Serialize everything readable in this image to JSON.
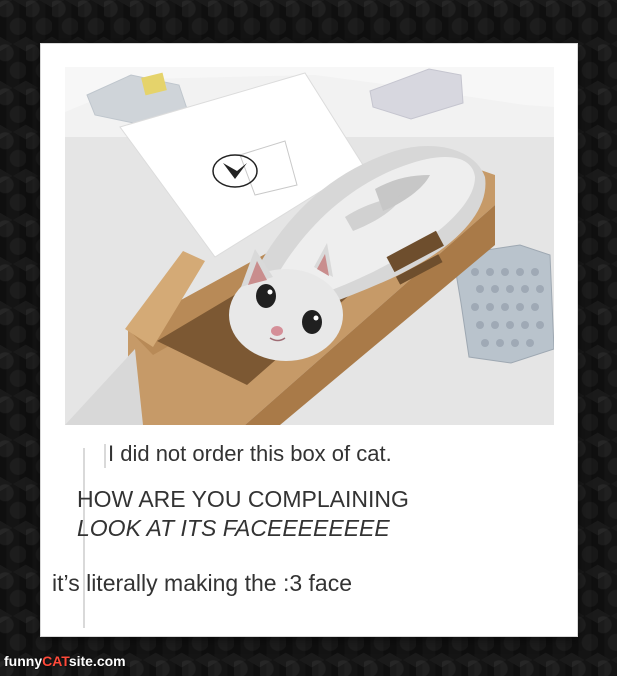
{
  "caption": {
    "post1": "I did not order this box of cat.",
    "post2_line1": "HOW ARE YOU COMPLAINING",
    "post2_line2": "LOOK AT ITS FACEEEEEEEE",
    "post3": "it’s literally making the :3 face"
  },
  "watermark": {
    "prefix": "funny",
    "highlight": "CAT",
    "suffix": "site.com"
  }
}
